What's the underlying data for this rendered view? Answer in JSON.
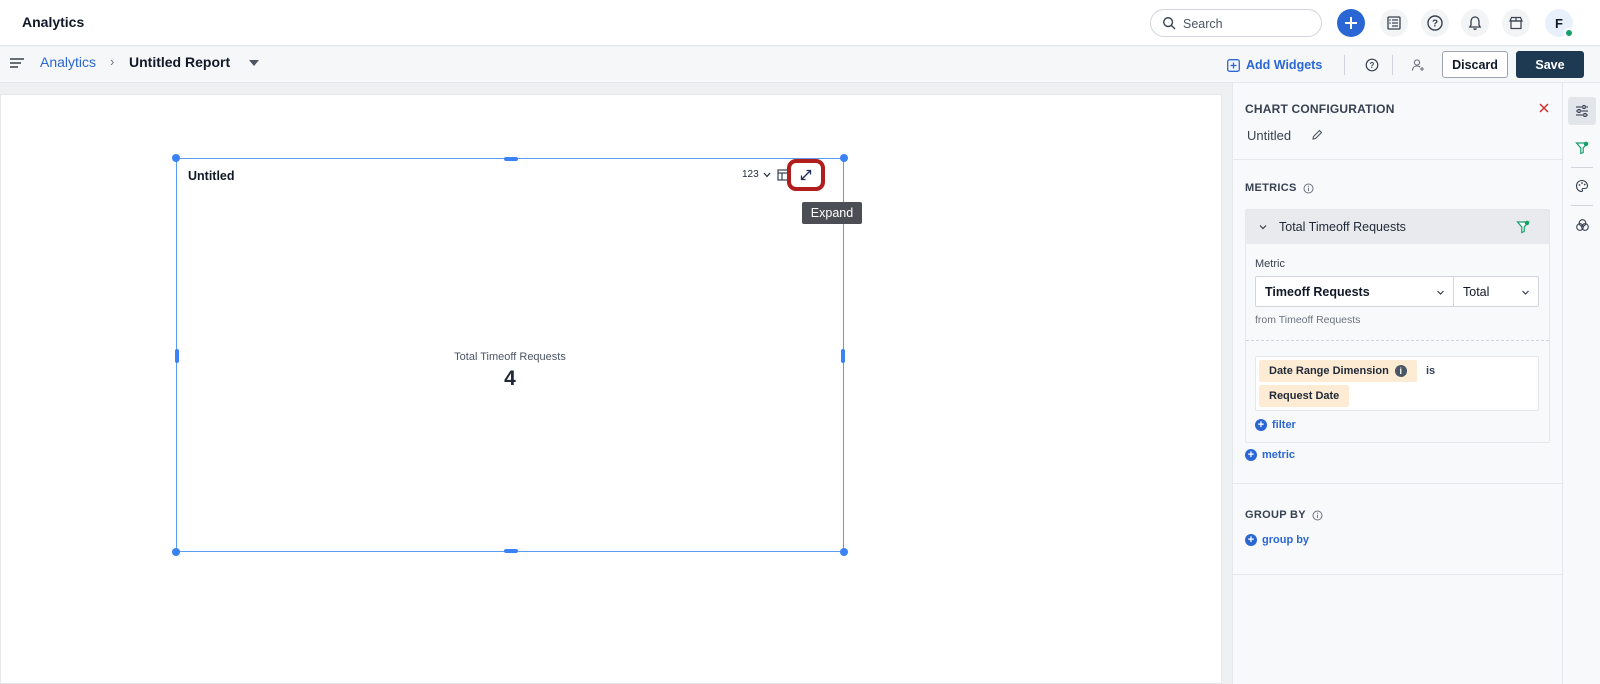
{
  "app": {
    "title": "Analytics"
  },
  "topbar": {
    "search_placeholder": "Search",
    "avatar_initial": "F"
  },
  "breadcrumb": {
    "parent": "Analytics",
    "separator": "›",
    "current": "Untitled Report"
  },
  "toolbar": {
    "add_widgets_label": "Add Widgets",
    "discard_label": "Discard",
    "save_label": "Save"
  },
  "widget": {
    "title": "Untitled",
    "chart_type_label": "123",
    "expand_tooltip": "Expand",
    "kpi_label": "Total Timeoff Requests",
    "kpi_value": "4"
  },
  "config": {
    "title": "CHART CONFIGURATION",
    "chart_name": "Untitled",
    "metrics_label": "METRICS",
    "metric": {
      "title": "Total Timeoff Requests",
      "field_label": "Metric",
      "metric_select": "Timeoff Requests",
      "aggregation_select": "Total",
      "source_text": "from Timeoff Requests",
      "filter_dimension": "Date Range Dimension",
      "filter_operator": "is",
      "filter_value": "Request Date",
      "add_filter_label": "filter"
    },
    "add_metric_label": "metric",
    "group_by_label": "GROUP BY",
    "add_group_by_label": "group by"
  },
  "colors": {
    "accent": "#2b67d4",
    "save_bg": "#1e3a52",
    "selection": "#3b82f6",
    "highlight": "#b11c1c",
    "chip_bg": "#fdebd3",
    "status_online": "#15a06a"
  }
}
